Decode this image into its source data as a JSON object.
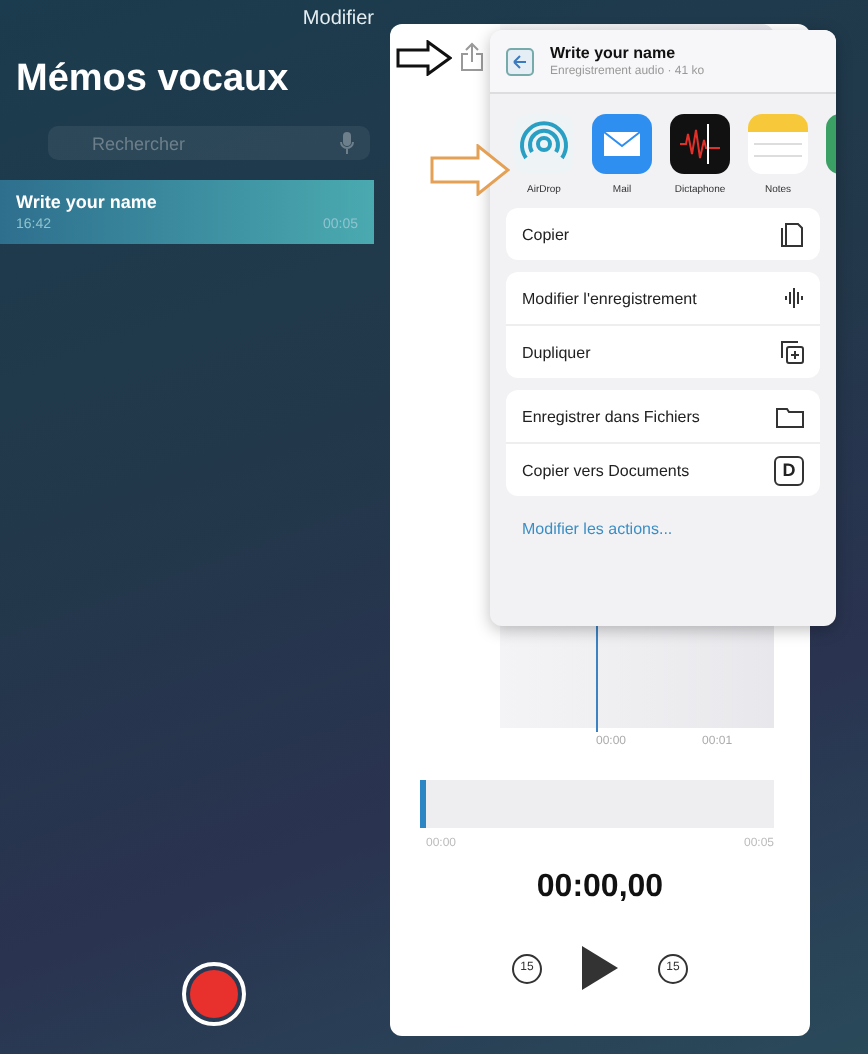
{
  "sidebar": {
    "edit_label": "Modifier",
    "title": "Mémos vocaux",
    "search": {
      "placeholder": "Rechercher"
    },
    "recordings": [
      {
        "name": "Write your name",
        "time": "16:42",
        "duration": "00:05",
        "selected": true
      }
    ]
  },
  "player": {
    "waveform_ticks": [
      "00:00",
      "00:01"
    ],
    "scrubber": {
      "level": 0,
      "start": "00:00",
      "end": "00:05"
    },
    "elapsed": "00:00,00",
    "skip_back": "15",
    "skip_forward": "15"
  },
  "share_sheet": {
    "file_name": "Write your name",
    "file_info": "Enregistrement audio · 41 ko",
    "apps": [
      {
        "label": "AirDrop",
        "kind": "airdrop"
      },
      {
        "label": "Mail",
        "kind": "mail"
      },
      {
        "label": "Dictaphone",
        "kind": "dictaphone"
      },
      {
        "label": "Notes",
        "kind": "notes"
      },
      {
        "kind": "partial"
      }
    ],
    "action_groups": [
      [
        {
          "label": "Copier",
          "kind": "copy"
        }
      ],
      [
        {
          "label": "Modifier l'enregistrement",
          "kind": "wave"
        },
        {
          "label": "Dupliquer",
          "kind": "duplicate"
        }
      ],
      [
        {
          "label": "Enregistrer dans Fichiers",
          "kind": "folder"
        },
        {
          "label": "Copier vers Documents",
          "kind": "documents",
          "badge": "D"
        }
      ]
    ],
    "edit_actions": "Modifier les actions..."
  }
}
